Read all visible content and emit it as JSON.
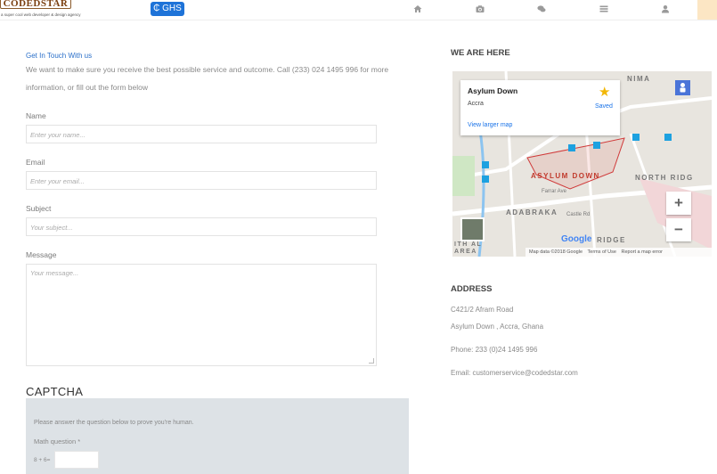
{
  "header": {
    "logo_text": "CODEDSTAR",
    "logo_tagline": "a super cool web developer & design agency",
    "currency_label": "₵ GHS",
    "nav_icons": [
      "home-icon",
      "camera-icon",
      "chat-icon",
      "list-icon",
      "user-icon"
    ]
  },
  "contact": {
    "heading": "Get In Touch With us",
    "intro": "We want to make sure you receive the best possible service and outcome. Call (233) 024 1495 996 for more information, or fill out the form below",
    "name_label": "Name",
    "name_placeholder": "Enter your name...",
    "email_label": "Email",
    "email_placeholder": "Enter your email...",
    "subject_label": "Subject",
    "subject_placeholder": "Your subject...",
    "message_label": "Message",
    "message_placeholder": "Your message..."
  },
  "captcha": {
    "title": "CAPTCHA",
    "note": "Please answer the question below to prove you're human.",
    "label": "Math question *",
    "question": "8 + 6="
  },
  "map_section": {
    "heading": "WE ARE HERE",
    "card_title": "Asylum Down",
    "card_subtitle": "Accra",
    "card_link": "View larger map",
    "card_saved": "Saved",
    "labels": {
      "nima": "NIMA",
      "asylum_down": "ASYLUM DOWN",
      "north_ridge": "NORTH RIDG",
      "adabraka": "ADABRAKA",
      "ridge": "RIDGE",
      "castle_rd": "Castle Rd",
      "farrar_ave": "Farrar Ave",
      "area": "ITH AL AREA"
    },
    "zoom_in": "+",
    "zoom_out": "−",
    "google_logo": "Google",
    "footer": [
      "Map data ©2018 Google",
      "Terms of Use",
      "Report a map error"
    ]
  },
  "address": {
    "heading": "ADDRESS",
    "line1": "C421/2 Afram Road",
    "line2": "Asylum Down , Accra, Ghana",
    "phone": "Phone: 233 (0)24 1495 996",
    "email": "Email: customerservice@codedstar.com"
  },
  "colors": {
    "accent_blue": "#2a6fc9",
    "currency_button": "#1e73d8",
    "captcha_bg": "#dde2e6"
  }
}
